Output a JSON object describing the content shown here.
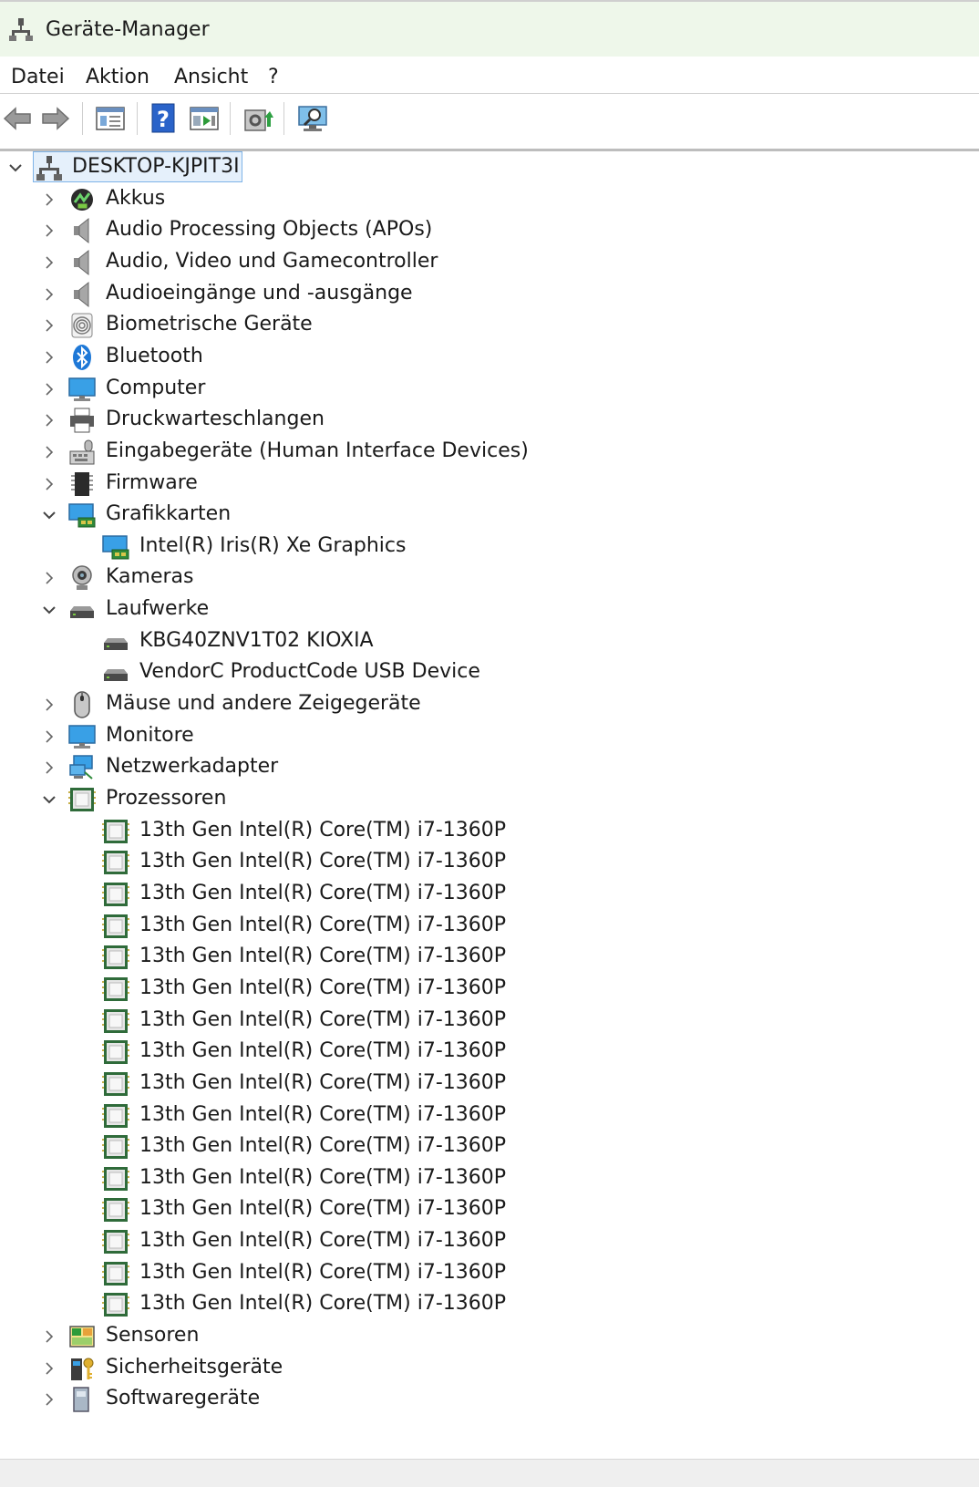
{
  "window": {
    "title": "Geräte-Manager"
  },
  "menu": [
    "Datei",
    "Aktion",
    "Ansicht",
    "?"
  ],
  "toolbar": [
    {
      "icon": "back-arrow-icon"
    },
    {
      "icon": "forward-arrow-icon"
    },
    {
      "icon": "properties-window-icon"
    },
    {
      "icon": "help-icon"
    },
    {
      "icon": "run-window-icon"
    },
    {
      "icon": "update-driver-icon"
    },
    {
      "icon": "scan-hardware-icon"
    }
  ],
  "tree": {
    "root": "DESKTOP-KJPIT3I",
    "categories": [
      {
        "label": "Akkus",
        "icon": "battery-icon",
        "expanded": false
      },
      {
        "label": "Audio Processing Objects (APOs)",
        "icon": "speaker-icon",
        "expanded": false
      },
      {
        "label": "Audio, Video und Gamecontroller",
        "icon": "speaker-icon",
        "expanded": false
      },
      {
        "label": "Audioeingänge und -ausgänge",
        "icon": "speaker-icon",
        "expanded": false
      },
      {
        "label": "Biometrische Geräte",
        "icon": "fingerprint-icon",
        "expanded": false
      },
      {
        "label": "Bluetooth",
        "icon": "bluetooth-icon",
        "expanded": false
      },
      {
        "label": "Computer",
        "icon": "monitor-icon",
        "expanded": false
      },
      {
        "label": "Druckwarteschlangen",
        "icon": "printer-icon",
        "expanded": false
      },
      {
        "label": "Eingabegeräte (Human Interface Devices)",
        "icon": "hid-icon",
        "expanded": false
      },
      {
        "label": "Firmware",
        "icon": "firmware-chip-icon",
        "expanded": false
      },
      {
        "label": "Grafikkarten",
        "icon": "display-adapter-icon",
        "expanded": true,
        "children": [
          {
            "label": "Intel(R) Iris(R) Xe Graphics",
            "icon": "display-adapter-icon"
          }
        ]
      },
      {
        "label": "Kameras",
        "icon": "webcam-icon",
        "expanded": false
      },
      {
        "label": "Laufwerke",
        "icon": "disk-drive-icon",
        "expanded": true,
        "children": [
          {
            "label": "KBG40ZNV1T02 KIOXIA",
            "icon": "disk-drive-icon"
          },
          {
            "label": "VendorC ProductCode USB Device",
            "icon": "disk-drive-icon"
          }
        ]
      },
      {
        "label": "Mäuse und andere Zeigegeräte",
        "icon": "mouse-icon",
        "expanded": false
      },
      {
        "label": "Monitore",
        "icon": "monitor-icon",
        "expanded": false
      },
      {
        "label": "Netzwerkadapter",
        "icon": "network-adapter-icon",
        "expanded": false
      },
      {
        "label": "Prozessoren",
        "icon": "processor-icon",
        "expanded": true,
        "children": [
          {
            "label": "13th Gen Intel(R) Core(TM) i7-1360P",
            "icon": "processor-icon"
          },
          {
            "label": "13th Gen Intel(R) Core(TM) i7-1360P",
            "icon": "processor-icon"
          },
          {
            "label": "13th Gen Intel(R) Core(TM) i7-1360P",
            "icon": "processor-icon"
          },
          {
            "label": "13th Gen Intel(R) Core(TM) i7-1360P",
            "icon": "processor-icon"
          },
          {
            "label": "13th Gen Intel(R) Core(TM) i7-1360P",
            "icon": "processor-icon"
          },
          {
            "label": "13th Gen Intel(R) Core(TM) i7-1360P",
            "icon": "processor-icon"
          },
          {
            "label": "13th Gen Intel(R) Core(TM) i7-1360P",
            "icon": "processor-icon"
          },
          {
            "label": "13th Gen Intel(R) Core(TM) i7-1360P",
            "icon": "processor-icon"
          },
          {
            "label": "13th Gen Intel(R) Core(TM) i7-1360P",
            "icon": "processor-icon"
          },
          {
            "label": "13th Gen Intel(R) Core(TM) i7-1360P",
            "icon": "processor-icon"
          },
          {
            "label": "13th Gen Intel(R) Core(TM) i7-1360P",
            "icon": "processor-icon"
          },
          {
            "label": "13th Gen Intel(R) Core(TM) i7-1360P",
            "icon": "processor-icon"
          },
          {
            "label": "13th Gen Intel(R) Core(TM) i7-1360P",
            "icon": "processor-icon"
          },
          {
            "label": "13th Gen Intel(R) Core(TM) i7-1360P",
            "icon": "processor-icon"
          },
          {
            "label": "13th Gen Intel(R) Core(TM) i7-1360P",
            "icon": "processor-icon"
          },
          {
            "label": "13th Gen Intel(R) Core(TM) i7-1360P",
            "icon": "processor-icon"
          }
        ]
      },
      {
        "label": "Sensoren",
        "icon": "sensor-icon",
        "expanded": false
      },
      {
        "label": "Sicherheitsgeräte",
        "icon": "security-key-icon",
        "expanded": false
      },
      {
        "label": "Softwaregeräte",
        "icon": "software-device-icon",
        "expanded": false
      }
    ]
  },
  "colors": {
    "titlebar_bg": "#eef7ea",
    "selection_bg": "#e5f0fb",
    "selection_border": "#7fb4e8",
    "chip_green": "#2f6b3a",
    "accent_blue": "#1e78d7"
  }
}
